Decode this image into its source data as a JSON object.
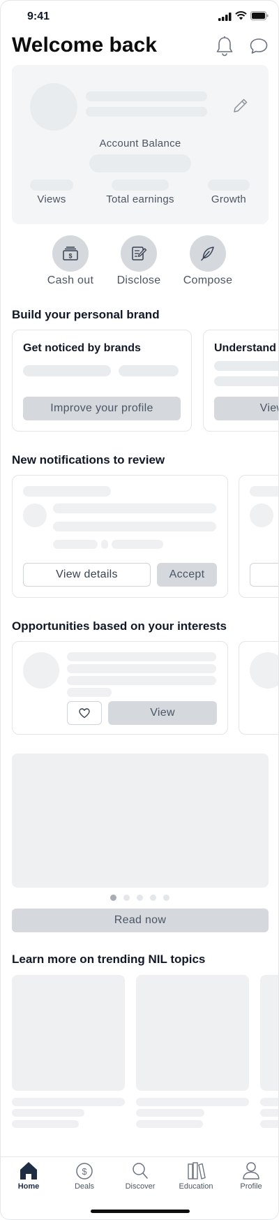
{
  "status_bar": {
    "time": "9:41"
  },
  "header": {
    "title": "Welcome back"
  },
  "profile_card": {
    "balance_label": "Account Balance",
    "stats": [
      "Views",
      "Total earnings",
      "Growth"
    ]
  },
  "quick_actions": [
    {
      "label": "Cash out",
      "icon": "cash-icon"
    },
    {
      "label": "Disclose",
      "icon": "disclose-icon"
    },
    {
      "label": "Compose",
      "icon": "feather-icon"
    }
  ],
  "brand_section": {
    "title": "Build your personal brand",
    "cards": [
      {
        "title": "Get noticed by brands",
        "button": "Improve your profile"
      },
      {
        "title": "Understand",
        "button": "View s"
      }
    ]
  },
  "notifications_section": {
    "title": "New notifications to review",
    "view_details": "View details",
    "accept": "Accept"
  },
  "opportunities_section": {
    "title": "Opportunities based on your interests",
    "view": "View"
  },
  "carousel": {
    "read_now": "Read now",
    "dot_count": 5,
    "active_dot": 0
  },
  "trending_section": {
    "title": "Learn more on trending NIL topics"
  },
  "bottom_nav": [
    {
      "label": "Home",
      "icon": "home-icon",
      "active": true
    },
    {
      "label": "Deals",
      "icon": "dollar-icon",
      "active": false
    },
    {
      "label": "Discover",
      "icon": "search-icon",
      "active": false
    },
    {
      "label": "Education",
      "icon": "books-icon",
      "active": false
    },
    {
      "label": "Profile",
      "icon": "user-icon",
      "active": false
    }
  ],
  "colors": {
    "accent": "#1f2d44",
    "skeleton": "#e9ecef",
    "button_gray": "#d5d9de"
  }
}
